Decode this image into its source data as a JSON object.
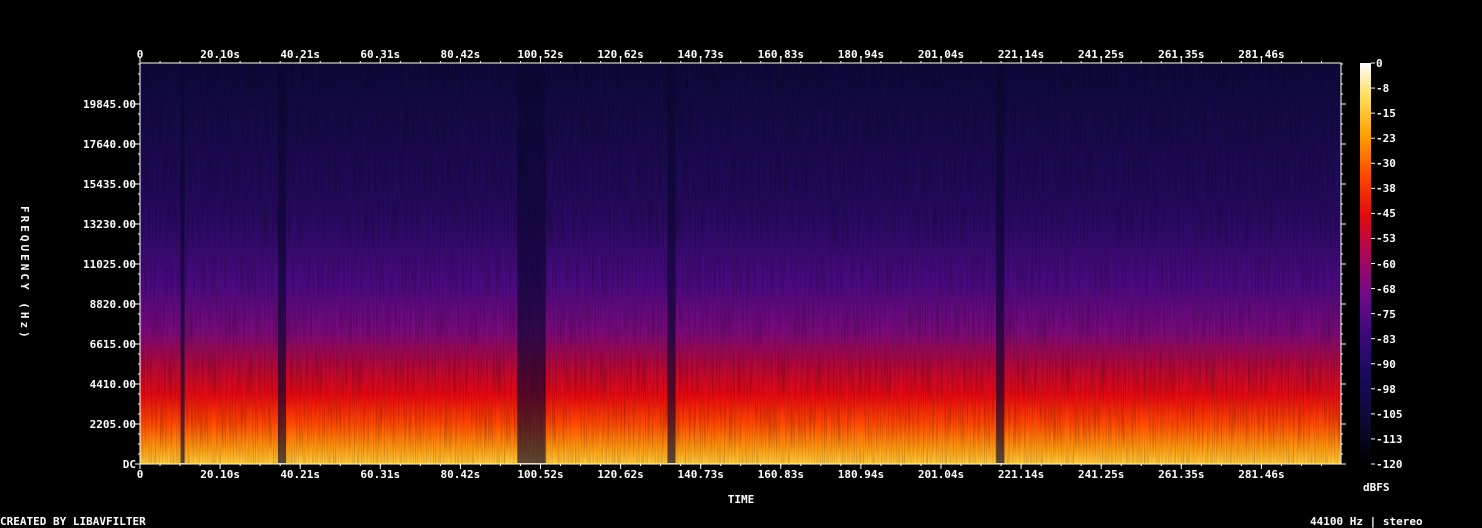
{
  "chart_data": {
    "type": "heatmap",
    "title": "",
    "xlabel": "TIME",
    "ylabel": "FREQUENCY (Hz)",
    "colorbar_label": "dBFS",
    "x_ticks": [
      "0",
      "20.10s",
      "40.21s",
      "60.31s",
      "80.42s",
      "100.52s",
      "120.62s",
      "140.73s",
      "160.83s",
      "180.94s",
      "201.04s",
      "221.14s",
      "241.25s",
      "261.35s",
      "281.46s"
    ],
    "y_ticks": [
      "DC",
      "2205.00",
      "4410.00",
      "6615.00",
      "8820.00",
      "11025.00",
      "13230.00",
      "15435.00",
      "17640.00",
      "19845.00"
    ],
    "colorbar_ticks": [
      "0",
      "-8",
      "-15",
      "-23",
      "-30",
      "-38",
      "-45",
      "-53",
      "-60",
      "-68",
      "-75",
      "-83",
      "-90",
      "-98",
      "-105",
      "-113",
      "-120"
    ],
    "xlim_s": [
      0,
      296
    ],
    "ylim_hz": [
      0,
      22050
    ],
    "clim_dbfs": [
      -120,
      0
    ],
    "colormap": [
      "#000000",
      "#140a40",
      "#3a0a7a",
      "#7a0a90",
      "#b00a40",
      "#e00a00",
      "#ff5500",
      "#ffb000",
      "#ffee60",
      "#ffffff"
    ],
    "quiet_sections_s": [
      [
        10,
        11
      ],
      [
        34,
        36
      ],
      [
        93,
        100
      ],
      [
        130,
        132
      ],
      [
        211,
        213
      ]
    ]
  },
  "footer": {
    "left": "CREATED BY LIBAVFILTER",
    "right": "44100 Hz | stereo"
  }
}
